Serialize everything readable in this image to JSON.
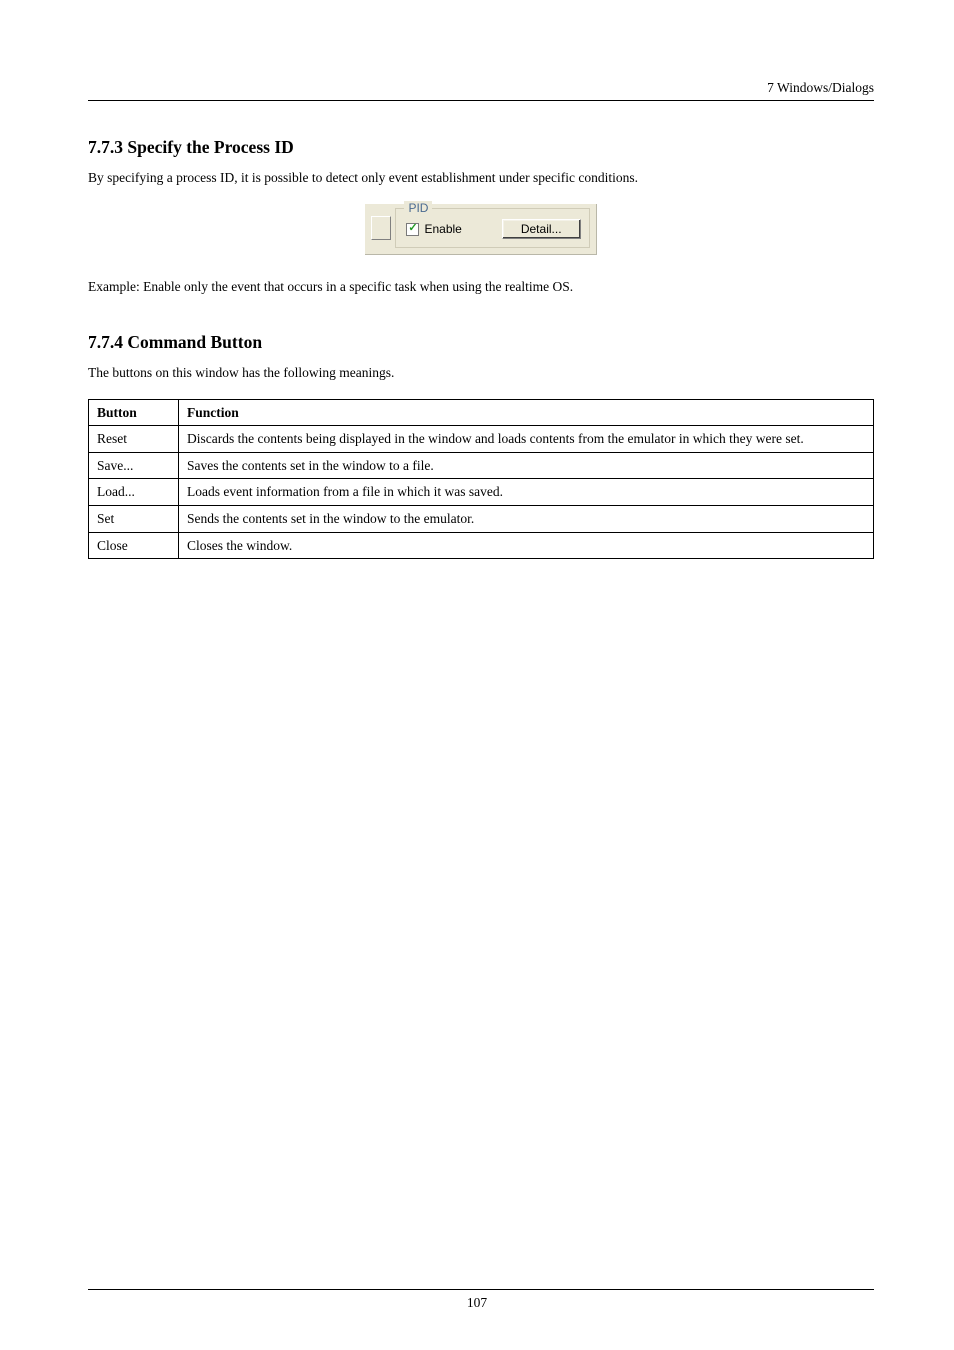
{
  "header": {
    "right": "7  Windows/Dialogs"
  },
  "section1": {
    "heading": "7.7.3 Specify the Process ID",
    "intro": "By specifying a process ID, it is possible to detect only event establishment under specific conditions.",
    "example": "Example: Enable only the event that occurs in a specific task when using the realtime OS."
  },
  "gui": {
    "legend": "PID",
    "checkbox_label": "Enable",
    "checkbox_checked": true,
    "detail_button": "Detail..."
  },
  "section2": {
    "heading": "7.7.4 Command Button",
    "intro": "The buttons on this window has the following meanings."
  },
  "table": {
    "headers": {
      "col1": "Button",
      "col2": "Function"
    },
    "rows": [
      {
        "button": "Reset",
        "function": "Discards the contents being displayed in the window and loads contents from the emulator in which they were set."
      },
      {
        "button": "Save...",
        "function": "Saves the contents set in the window to a file."
      },
      {
        "button": "Load...",
        "function": "Loads event information from a file in which it was saved."
      },
      {
        "button": "Set",
        "function": "Sends the contents set in the window to the emulator."
      },
      {
        "button": "Close",
        "function": "Closes the window."
      }
    ]
  },
  "footer": {
    "page": "107"
  }
}
